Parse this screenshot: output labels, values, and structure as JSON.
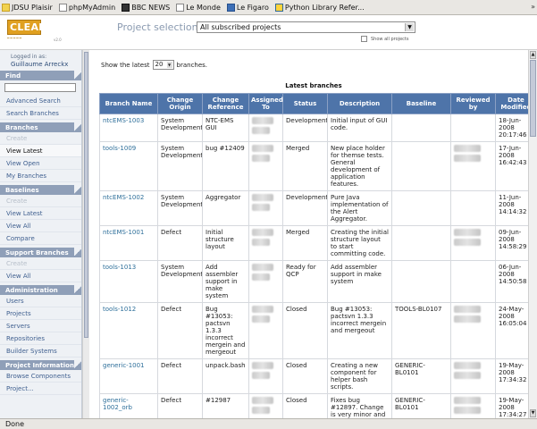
{
  "bookmarks": [
    "JDSU Plaisir",
    "phpMyAdmin",
    "BBC NEWS",
    "Le Monde",
    "Le Figaro",
    "Python Library Refer..."
  ],
  "header": {
    "logo_text": "CLEAR",
    "logo_version": "v2.0",
    "project_label": "Project selection",
    "project_value": "All subscribed projects",
    "show_all_label": "Show all projects"
  },
  "sidebar": {
    "logged_in_label": "Logged in as:",
    "user_name": "Guillaume Arreckx",
    "sections": [
      {
        "title": "Find",
        "has_input": true,
        "items": [
          {
            "label": "Advanced Search"
          },
          {
            "label": "Search Branches"
          }
        ]
      },
      {
        "title": "Branches",
        "items": [
          {
            "label": "Create",
            "state": "disabled"
          },
          {
            "label": "View Latest",
            "state": "active"
          },
          {
            "label": "View Open"
          },
          {
            "label": "My Branches"
          }
        ]
      },
      {
        "title": "Baselines",
        "items": [
          {
            "label": "Create",
            "state": "disabled"
          },
          {
            "label": "View Latest"
          },
          {
            "label": "View All"
          },
          {
            "label": "Compare"
          }
        ]
      },
      {
        "title": "Support Branches",
        "items": [
          {
            "label": "Create",
            "state": "disabled"
          },
          {
            "label": "View All"
          }
        ]
      },
      {
        "title": "Administration",
        "items": [
          {
            "label": "Users"
          },
          {
            "label": "Projects"
          },
          {
            "label": "Servers"
          },
          {
            "label": "Repositories"
          },
          {
            "label": "Builder Systems"
          }
        ]
      },
      {
        "title": "Project Information",
        "items": [
          {
            "label": "Browse Components"
          },
          {
            "label": "Project..."
          }
        ]
      }
    ]
  },
  "main": {
    "show_prefix": "Show the latest",
    "show_count": "20",
    "show_suffix": "branches.",
    "table_title": "Latest branches",
    "columns": [
      "Branch Name",
      "Change Origin",
      "Change Reference",
      "Assigned To",
      "Status",
      "Description",
      "Baseline",
      "Reviewed by",
      "Date Modified"
    ],
    "rows": [
      {
        "branch": "ntcEMS-1003",
        "origin": "System Development",
        "reference": "NTC-EMS GUI",
        "status": "Development",
        "description": "Initial input of GUI code.",
        "baseline": "",
        "reviewed": false,
        "date": "18-Jun-2008 20:17:46"
      },
      {
        "branch": "tools-1009",
        "origin": "System Development",
        "reference": "bug #12409",
        "status": "Merged",
        "description": "New place holder for themse tests. General development of application features.",
        "baseline": "",
        "reviewed": true,
        "date": "17-Jun-2008 16:42:43"
      },
      {
        "branch": "ntcEMS-1002",
        "origin": "System Development",
        "reference": "Aggregator",
        "status": "Development",
        "description": "Pure Java implementation of the Alert Aggregator.",
        "baseline": "",
        "reviewed": false,
        "date": "11-Jun-2008 14:14:32"
      },
      {
        "branch": "ntcEMS-1001",
        "origin": "Defect",
        "reference": "Initial structure layout",
        "status": "Merged",
        "description": "Creating the initial structure layout to start committing code.",
        "baseline": "",
        "reviewed": true,
        "date": "09-Jun-2008 14:58:29"
      },
      {
        "branch": "tools-1013",
        "origin": "System Development",
        "reference": "Add assembler support in make system",
        "status": "Ready for QCP",
        "description": "Add assembler support in make system",
        "baseline": "",
        "reviewed": false,
        "date": "06-Jun-2008 14:50:58"
      },
      {
        "branch": "tools-1012",
        "origin": "Defect",
        "reference": "Bug #13053: pactsvn 1.3.3 incorrect mergein and mergeout",
        "status": "Closed",
        "description": "Bug #13053: pactsvn 1.3.3 incorrect mergein and mergeout",
        "baseline": "TOOLS-BL0107",
        "reviewed": true,
        "date": "24-May-2008 16:05:04"
      },
      {
        "branch": "generic-1001",
        "origin": "Defect",
        "reference": "unpack.bash",
        "status": "Closed",
        "description": "Creating a new component for helper bash scripts.",
        "baseline": "GENERIC-BL0101",
        "reviewed": true,
        "date": "19-May-2008 17:34:32"
      },
      {
        "branch": "generic-1002_orb",
        "origin": "Defect",
        "reference": "#12987",
        "status": "Closed",
        "description": "Fixes bug #12897. Change is very minor and corrects the debug output on orb shutdown.",
        "baseline": "GENERIC-BL0101",
        "reviewed": true,
        "date": "19-May-2008 17:34:27"
      }
    ]
  },
  "status_bar": "Done"
}
